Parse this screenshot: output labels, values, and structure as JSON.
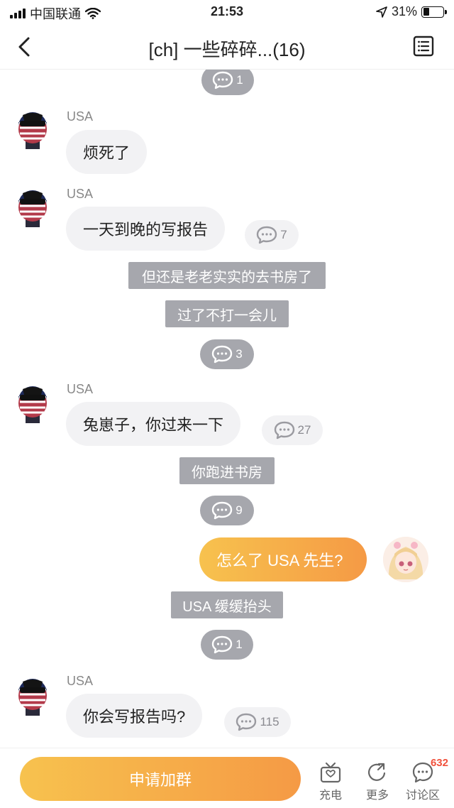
{
  "status_bar": {
    "carrier": "中国联通",
    "time": "21:53",
    "battery": "31%",
    "battery_level": 0.31
  },
  "nav": {
    "title": "[ch] 一些碎碎...(16)"
  },
  "messages": {
    "top_comment": "1",
    "m1": {
      "name": "USA",
      "text": "烦死了"
    },
    "m2": {
      "name": "USA",
      "text": "一天到晚的写报告",
      "comments": "7"
    },
    "narr1": "但还是老老实实的去书房了",
    "narr2": "过了不打一会儿",
    "c3": "3",
    "m3": {
      "name": "USA",
      "text": "兔崽子，你过来一下",
      "comments": "27"
    },
    "narr3": "你跑进书房",
    "c9": "9",
    "me1": {
      "text": "怎么了 USA 先生?"
    },
    "narr4": "USA 缓缓抬头",
    "c1b": "1",
    "m4": {
      "name": "USA",
      "text": "你会写报告吗?",
      "comments": "115"
    }
  },
  "bottom": {
    "join_label": "申请加群",
    "charge_label": "充电",
    "more_label": "更多",
    "discuss_label": "讨论区",
    "discuss_badge": "632"
  },
  "colors": {
    "accent_start": "#f7c24e",
    "accent_end": "#f59a45",
    "pill_grey": "#a6a7ad",
    "bubble_grey": "#f2f2f4"
  }
}
